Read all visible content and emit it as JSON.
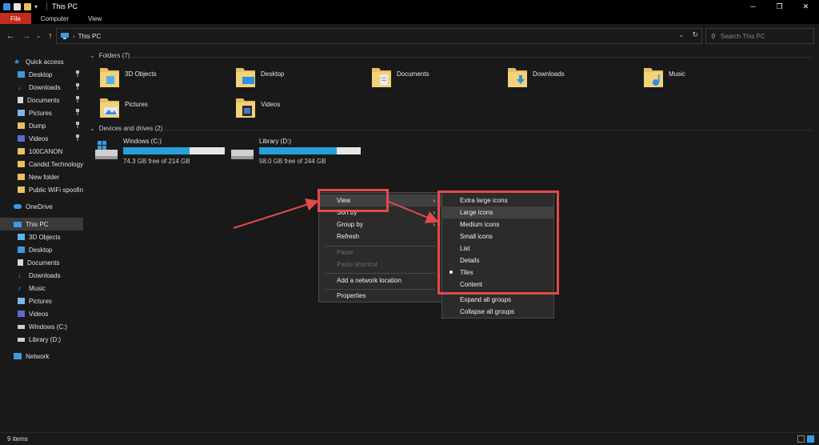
{
  "window": {
    "title": "This PC"
  },
  "ribbon": {
    "tabs": [
      "File",
      "Computer",
      "View"
    ]
  },
  "address": {
    "path": "This PC",
    "search_placeholder": "Search This PC"
  },
  "nav": {
    "quick_access": "Quick access",
    "quick_items": [
      "Desktop",
      "Downloads",
      "Documents",
      "Pictures",
      "Dump",
      "Videos",
      "100CANON",
      "Candid.Technology",
      "New folder",
      "Public WiFi spoofing"
    ],
    "onedrive": "OneDrive",
    "this_pc": "This PC",
    "pc_items": [
      "3D Objects",
      "Desktop",
      "Documents",
      "Downloads",
      "Music",
      "Pictures",
      "Videos",
      "Windows (C:)",
      "Library (D:)"
    ],
    "network": "Network"
  },
  "content": {
    "folders_header": "Folders (7)",
    "folders": [
      "3D Objects",
      "Desktop",
      "Documents",
      "Downloads",
      "Music",
      "Pictures",
      "Videos"
    ],
    "drives_header": "Devices and drives (2)",
    "drives": [
      {
        "name": "Windows (C:)",
        "free": "74.3 GB free of 214 GB",
        "used_fraction": 0.65
      },
      {
        "name": "Library (D:)",
        "free": "58.0 GB free of 244 GB",
        "used_fraction": 0.76
      }
    ]
  },
  "context_menu": {
    "items": [
      "View",
      "Sort by",
      "Group by",
      "Refresh",
      "Paste",
      "Paste shortcut",
      "Add a network location",
      "Properties"
    ]
  },
  "view_submenu": {
    "items": [
      "Extra large icons",
      "Large icons",
      "Medium icons",
      "Small icons",
      "List",
      "Details",
      "Tiles",
      "Content"
    ],
    "extra": [
      "Expand all groups",
      "Collapse all groups"
    ]
  },
  "status": {
    "items_count": "9 items"
  },
  "colors": {
    "accent_red": "#c42b1c",
    "highlight_red": "#e34a4a",
    "drive_bar_blue": "#26a0da",
    "folder_yellow": "#e8c15c"
  }
}
